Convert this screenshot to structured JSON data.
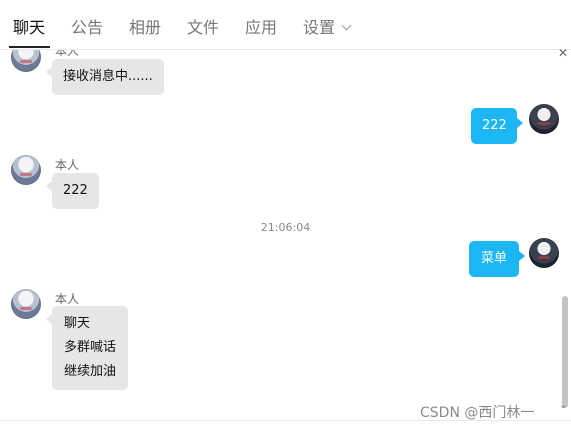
{
  "tabs": [
    {
      "label": "聊天"
    },
    {
      "label": "公告"
    },
    {
      "label": "相册"
    },
    {
      "label": "文件"
    },
    {
      "label": "应用"
    },
    {
      "label": "设置"
    }
  ],
  "messages": [
    {
      "sender": "本人",
      "text": "接收消息中......",
      "direction": "in"
    },
    {
      "text": "222",
      "direction": "out"
    },
    {
      "sender": "本人",
      "text": "222",
      "direction": "in"
    },
    {
      "timestamp": "21:06:04"
    },
    {
      "text": "菜单",
      "direction": "out"
    },
    {
      "sender": "本人",
      "lines": [
        "聊天",
        "多群喊话",
        "继续加油"
      ],
      "direction": "in"
    }
  ],
  "watermark": "CSDN @西门林一",
  "colors": {
    "outgoing_bubble": "#1cb6f5",
    "incoming_bubble": "#e6e6e6"
  }
}
